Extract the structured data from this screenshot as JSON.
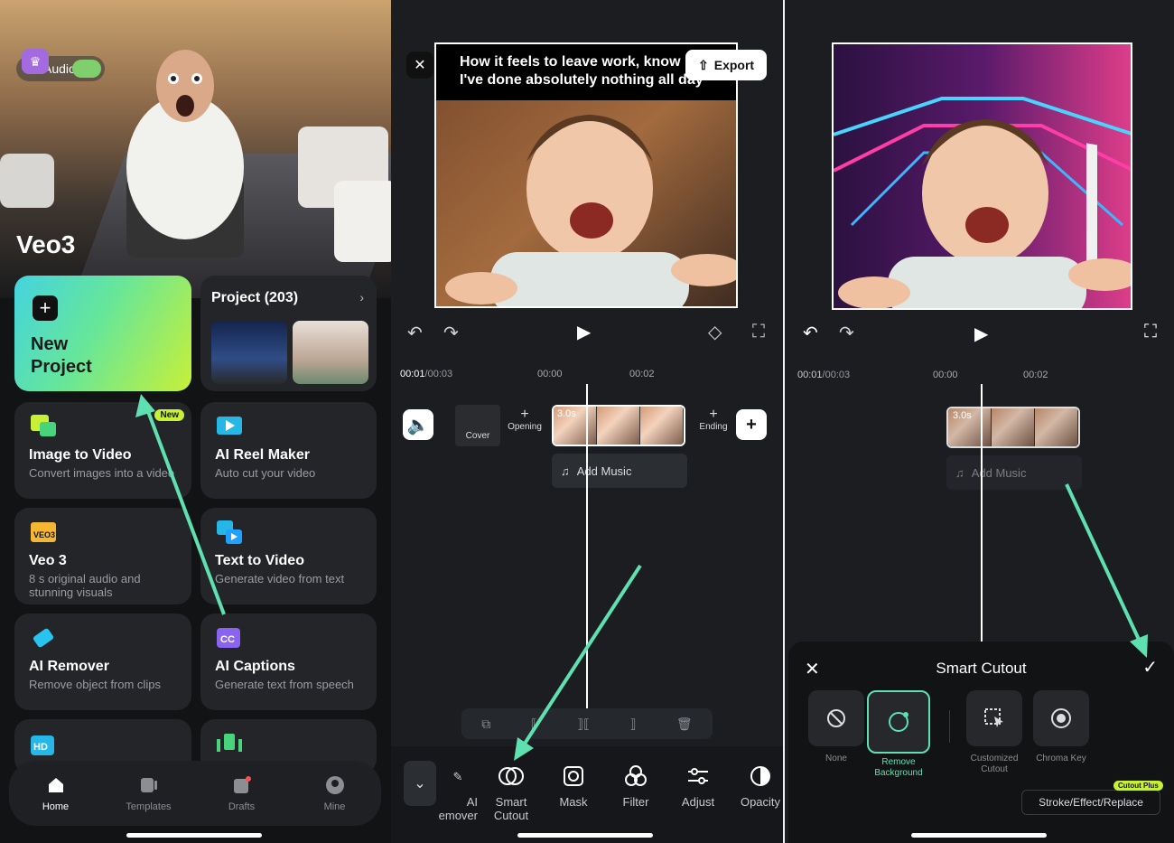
{
  "panel1": {
    "audio_label": "Audio",
    "hero_title": "Veo3",
    "new_project_label": "New Project",
    "project_title": "Project (203)",
    "tools": [
      {
        "title": "Image to Video",
        "desc": "Convert images into a video",
        "badge": "New"
      },
      {
        "title": "AI Reel Maker",
        "desc": "Auto cut your video"
      },
      {
        "title": "Veo 3",
        "desc": "8 s original audio and stunning visuals"
      },
      {
        "title": "Text to Video",
        "desc": "Generate video from text"
      },
      {
        "title": "AI Remover",
        "desc": "Remove object from clips"
      },
      {
        "title": "AI Captions",
        "desc": "Generate text from speech"
      }
    ],
    "nav": [
      "Home",
      "Templates",
      "Drafts",
      "Mine"
    ]
  },
  "panel2": {
    "caption": "How it feels to leave work, knowing I've done absolutely nothing all day",
    "caption_line1": "How it feels to leave work, know",
    "caption_line2": "I've done absolutely nothing all day",
    "export_label": "Export",
    "time_current": "00:01",
    "time_total": "/00:03",
    "ruler": [
      "00:00",
      "00:02"
    ],
    "cover_label": "Cover",
    "opening_label": "Opening",
    "ending_label": "Ending",
    "clip_duration": "3.0s",
    "add_music": "Add Music",
    "toolbar": [
      {
        "label": "AI Remover",
        "display": "AI\nmover"
      },
      {
        "label": "Smart Cutout"
      },
      {
        "label": "Mask"
      },
      {
        "label": "Filter"
      },
      {
        "label": "Adjust"
      },
      {
        "label": "Opacity"
      }
    ]
  },
  "panel3": {
    "time_current": "00:01",
    "time_total": "/00:03",
    "ruler": [
      "00:00",
      "00:02"
    ],
    "clip_duration": "3.0s",
    "add_music": "Add Music",
    "sheet_title": "Smart Cutout",
    "options": [
      "None",
      "Remove Background",
      "Customized Cutout",
      "Chroma Key"
    ],
    "stroke_label": "Stroke/Effect/Replace",
    "plus_badge": "Cutout Plus"
  },
  "accent_color": "#5fe0b0"
}
